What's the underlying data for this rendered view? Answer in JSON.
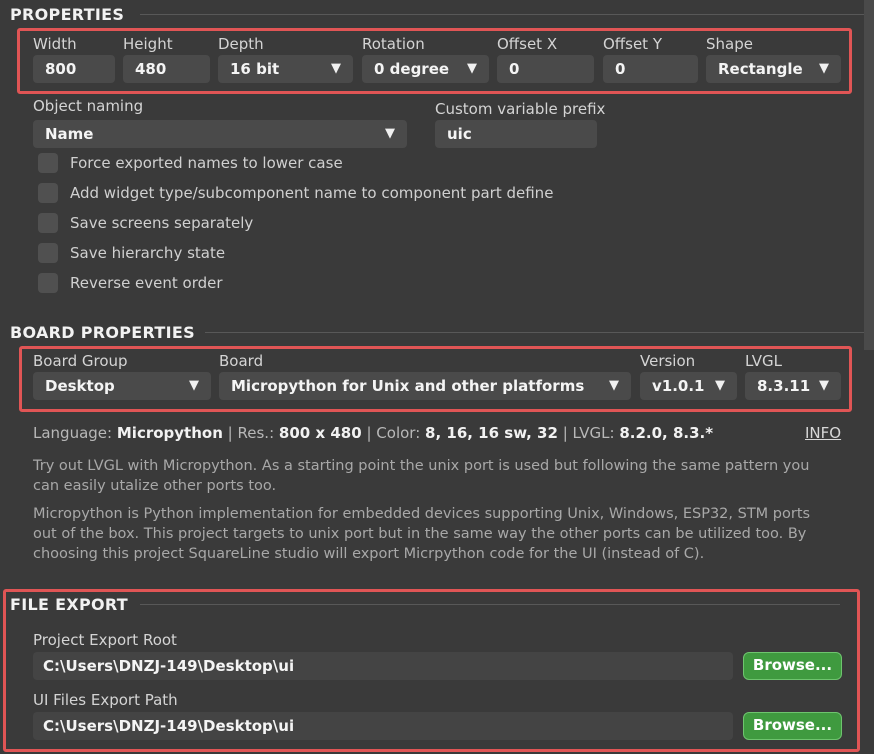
{
  "properties": {
    "title": "PROPERTIES",
    "width": {
      "label": "Width",
      "value": "800"
    },
    "height": {
      "label": "Height",
      "value": "480"
    },
    "depth": {
      "label": "Depth",
      "value": "16 bit"
    },
    "rotation": {
      "label": "Rotation",
      "value": "0 degree"
    },
    "offset_x": {
      "label": "Offset X",
      "value": "0"
    },
    "offset_y": {
      "label": "Offset Y",
      "value": "0"
    },
    "shape": {
      "label": "Shape",
      "value": "Rectangle"
    },
    "object_naming": {
      "label": "Object naming",
      "value": "Name"
    },
    "custom_prefix": {
      "label": "Custom variable prefix",
      "value": "uic"
    },
    "checkboxes": [
      {
        "label": "Force exported names to lower case",
        "checked": false
      },
      {
        "label": "Add widget type/subcomponent name to component part define",
        "checked": false
      },
      {
        "label": "Save screens separately",
        "checked": false
      },
      {
        "label": "Save hierarchy state",
        "checked": false
      },
      {
        "label": "Reverse event order",
        "checked": false
      }
    ]
  },
  "board": {
    "title": "BOARD PROPERTIES",
    "board_group": {
      "label": "Board Group",
      "value": "Desktop"
    },
    "board": {
      "label": "Board",
      "value": "Micropython for Unix and other platforms"
    },
    "version": {
      "label": "Version",
      "value": "v1.0.1"
    },
    "lvgl": {
      "label": "LVGL",
      "value": "8.3.11"
    },
    "info": {
      "language_label": "Language:",
      "language": "Micropython",
      "sep1": "|",
      "res_label": "Res.:",
      "res": "800 x 480",
      "sep2": "|",
      "color_label": "Color:",
      "color": "8, 16, 16 sw, 32",
      "sep3": "|",
      "lvgl_label": "LVGL:",
      "lvgl": "8.2.0, 8.3.*",
      "info_link": "INFO"
    },
    "desc1": "Try out LVGL with Micropython. As a starting point the unix port is used but following the same pattern you can easily utalize other ports too.",
    "desc2": "Micropython is Python implementation for embedded devices supporting Unix, Windows, ESP32, STM ports out of the box. This project targets to unix port but in the same way the other ports can be utilized too. By choosing this project SquareLine studio will export Micrpython code for the UI (instead of C)."
  },
  "file_export": {
    "title": "FILE EXPORT",
    "project_root": {
      "label": "Project Export Root",
      "value": "C:\\Users\\DNZJ-149\\Desktop\\ui"
    },
    "ui_files_path": {
      "label": "UI Files Export Path",
      "value": "C:\\Users\\DNZJ-149\\Desktop\\ui"
    },
    "browse_label": "Browse..."
  },
  "colors": {
    "highlight": "#e05555",
    "browse_green": "#3f9a3f",
    "panel_bg": "#3a3a3a",
    "field_bg": "#4a4a4a"
  }
}
